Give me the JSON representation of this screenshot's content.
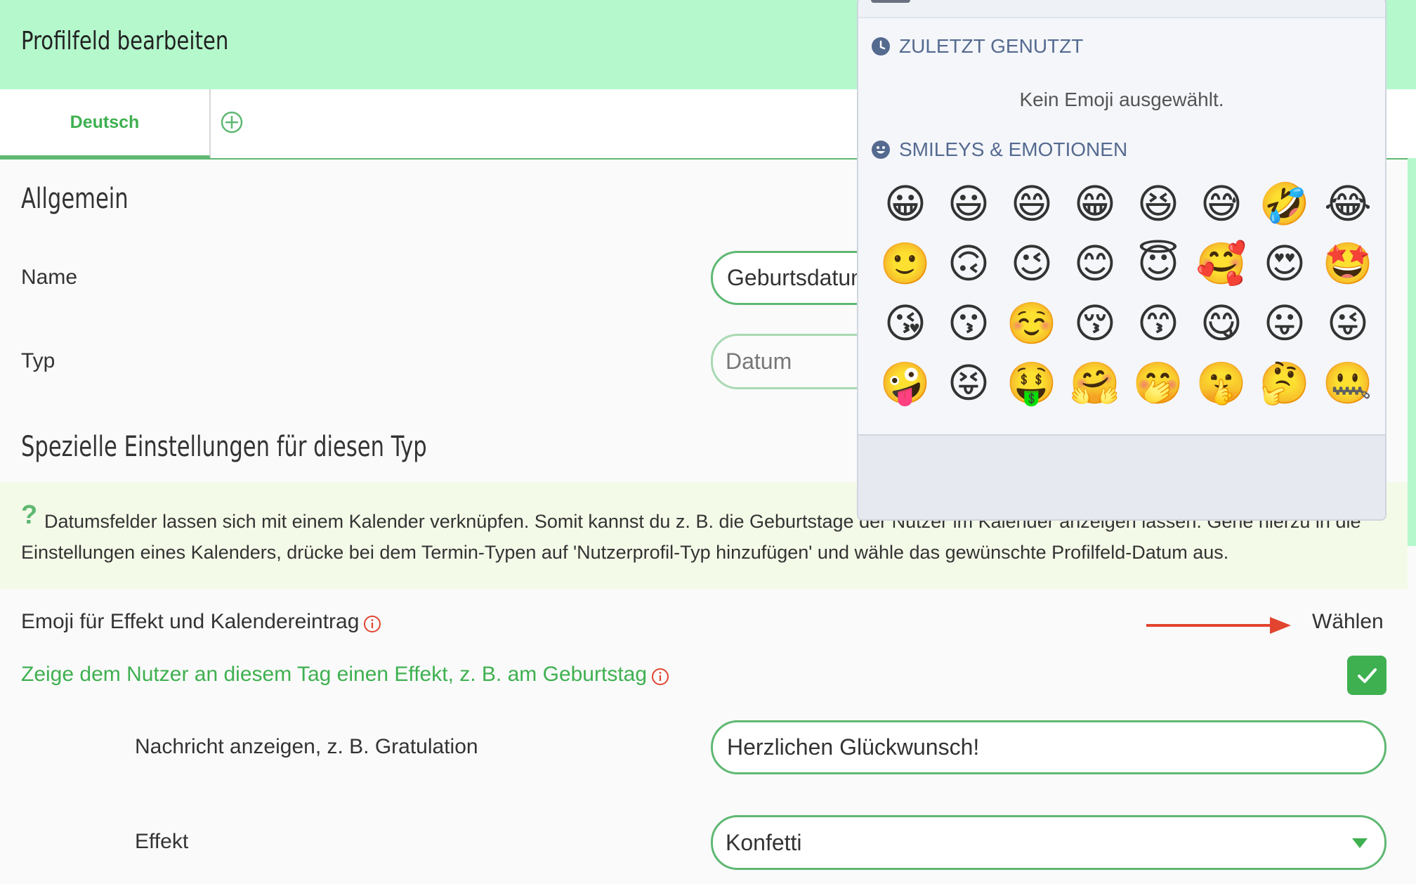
{
  "header": {
    "title": "Profilfeld bearbeiten"
  },
  "tabs": [
    {
      "label": "Deutsch"
    }
  ],
  "icons": {
    "add_tab": "plus-circle-icon",
    "info": "info-icon",
    "check": "checkmark-icon",
    "dropdown": "chevron-down-icon",
    "recent": "clock-icon",
    "smileys": "smiley-icon"
  },
  "colors": {
    "accent": "#5fb872",
    "header_bg": "#b4f8cc",
    "info_bg": "#f4fae8",
    "link_green": "#3fb050",
    "arrow": "#e2452f",
    "picker_heading": "#556a8f"
  },
  "general": {
    "heading": "Allgemein",
    "name_label": "Name",
    "name_value": "Geburtsdatum",
    "type_label": "Typ",
    "type_value": "Datum"
  },
  "special": {
    "heading": "Spezielle Einstellungen für diesen Typ",
    "info_marker": "?",
    "info_text": "Datumsfelder lassen sich mit einem Kalender verknüpfen. Somit kannst du z. B. die Geburtstage der Nutzer im Kalender anzeigen lassen. Gehe hierzu in die Einstellungen eines Kalenders, drücke bei dem Termin-Typen auf 'Nutzerprofil-Typ hinzufügen' und wähle das gewünschte Profilfeld-Datum aus."
  },
  "emoji_row": {
    "label": "Emoji für Effekt und Kalendereintrag",
    "action": "Wählen"
  },
  "effect_toggle": {
    "label": "Zeige dem Nutzer an diesem Tag einen Effekt, z. B. am Geburtstag",
    "checked": true
  },
  "message": {
    "label": "Nachricht anzeigen, z. B. Gratulation",
    "value": "Herzlichen Glückwunsch!"
  },
  "effect": {
    "label": "Effekt",
    "selected": "Konfetti"
  },
  "emoji_picker": {
    "recent_heading": "ZULETZT GENUTZT",
    "recent_empty": "Kein Emoji ausgewählt.",
    "smileys_heading": "SMILEYS & EMOTIONEN",
    "emojis": [
      "😀",
      "😃",
      "😄",
      "😁",
      "😆",
      "😅",
      "🤣",
      "😂",
      "🙂",
      "🙃",
      "😉",
      "😊",
      "😇",
      "🥰",
      "😍",
      "🤩",
      "😘",
      "😗",
      "☺️",
      "😚",
      "😙",
      "😋",
      "😛",
      "😜",
      "🤪",
      "😝",
      "🤑",
      "🤗",
      "🤭",
      "🤫",
      "🤔",
      "🤐",
      "🤨",
      "😐",
      "😑",
      "😶",
      "😏",
      "😒",
      "🙄",
      "😬"
    ]
  }
}
